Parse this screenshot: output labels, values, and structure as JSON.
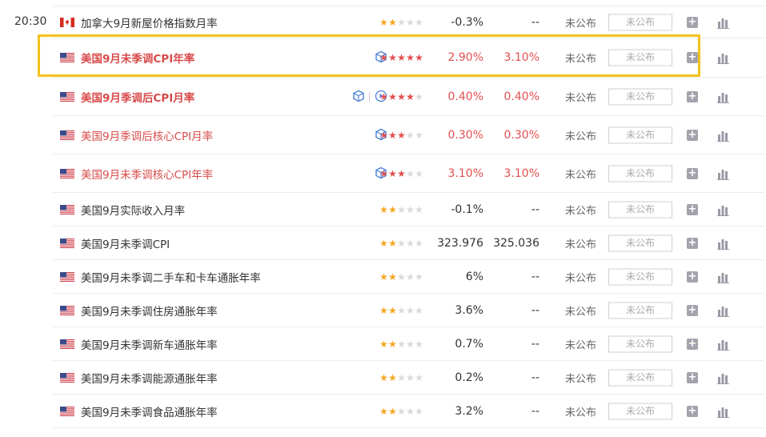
{
  "rows": [
    {
      "time": "20:30",
      "country": "CA",
      "name": "加拿大9月新屋价格指数月率",
      "highlight": false,
      "bold": false,
      "stars": 2,
      "red_stars": false,
      "previous": "-0.3%",
      "forecast": "--",
      "prev_red": false,
      "actual": "未公布",
      "button": "未公布",
      "icons": []
    },
    {
      "time": "",
      "country": "US",
      "name": "美国9月未季调CPI年率",
      "highlight": true,
      "bold": true,
      "stars": 5,
      "red_stars": true,
      "previous": "2.90%",
      "forecast": "3.10%",
      "prev_red": true,
      "actual": "未公布",
      "button": "未公布",
      "icons": [
        "cube-icon"
      ]
    },
    {
      "time": "",
      "country": "US",
      "name": "美国9月季调后CPI月率",
      "highlight": true,
      "bold": true,
      "stars": 4,
      "red_stars": true,
      "previous": "0.40%",
      "forecast": "0.40%",
      "prev_red": true,
      "actual": "未公布",
      "button": "未公布",
      "icons": [
        "cube-icon",
        "play-icon"
      ]
    },
    {
      "time": "",
      "country": "US",
      "name": "美国9月季调后核心CPI月率",
      "highlight": true,
      "bold": false,
      "stars": 3,
      "red_stars": true,
      "previous": "0.30%",
      "forecast": "0.30%",
      "prev_red": true,
      "actual": "未公布",
      "button": "未公布",
      "icons": [
        "cube-icon"
      ]
    },
    {
      "time": "",
      "country": "US",
      "name": "美国9月未季调核心CPI年率",
      "highlight": true,
      "bold": false,
      "stars": 3,
      "red_stars": true,
      "previous": "3.10%",
      "forecast": "3.10%",
      "prev_red": true,
      "actual": "未公布",
      "button": "未公布",
      "icons": [
        "cube-icon"
      ]
    },
    {
      "time": "",
      "country": "US",
      "name": "美国9月实际收入月率",
      "highlight": false,
      "bold": false,
      "stars": 2,
      "red_stars": false,
      "previous": "-0.1%",
      "forecast": "--",
      "prev_red": false,
      "actual": "未公布",
      "button": "未公布",
      "icons": []
    },
    {
      "time": "",
      "country": "US",
      "name": "美国9月未季调CPI",
      "highlight": false,
      "bold": false,
      "stars": 2,
      "red_stars": false,
      "previous": "323.976",
      "forecast": "325.036",
      "prev_red": false,
      "actual": "未公布",
      "button": "未公布",
      "icons": []
    },
    {
      "time": "",
      "country": "US",
      "name": "美国9月未季调二手车和卡车通胀年率",
      "highlight": false,
      "bold": false,
      "stars": 2,
      "red_stars": false,
      "previous": "6%",
      "forecast": "--",
      "prev_red": false,
      "actual": "未公布",
      "button": "未公布",
      "icons": []
    },
    {
      "time": "",
      "country": "US",
      "name": "美国9月未季调住房通胀年率",
      "highlight": false,
      "bold": false,
      "stars": 2,
      "red_stars": false,
      "previous": "3.6%",
      "forecast": "--",
      "prev_red": false,
      "actual": "未公布",
      "button": "未公布",
      "icons": []
    },
    {
      "time": "",
      "country": "US",
      "name": "美国9月未季调新车通胀年率",
      "highlight": false,
      "bold": false,
      "stars": 2,
      "red_stars": false,
      "previous": "0.7%",
      "forecast": "--",
      "prev_red": false,
      "actual": "未公布",
      "button": "未公布",
      "icons": []
    },
    {
      "time": "",
      "country": "US",
      "name": "美国9月未季调能源通胀年率",
      "highlight": false,
      "bold": false,
      "stars": 2,
      "red_stars": false,
      "previous": "0.2%",
      "forecast": "--",
      "prev_red": false,
      "actual": "未公布",
      "button": "未公布",
      "icons": []
    },
    {
      "time": "",
      "country": "US",
      "name": "美国9月未季调食品通胀年率",
      "highlight": false,
      "bold": false,
      "stars": 2,
      "red_stars": false,
      "previous": "3.2%",
      "forecast": "--",
      "prev_red": false,
      "actual": "未公布",
      "button": "未公布",
      "icons": []
    }
  ],
  "colors": {
    "highlight_text": "#d84b4b",
    "star_red": "#e34f4f",
    "star_gold": "#f5a623",
    "selection_border": "#f5c21a"
  }
}
